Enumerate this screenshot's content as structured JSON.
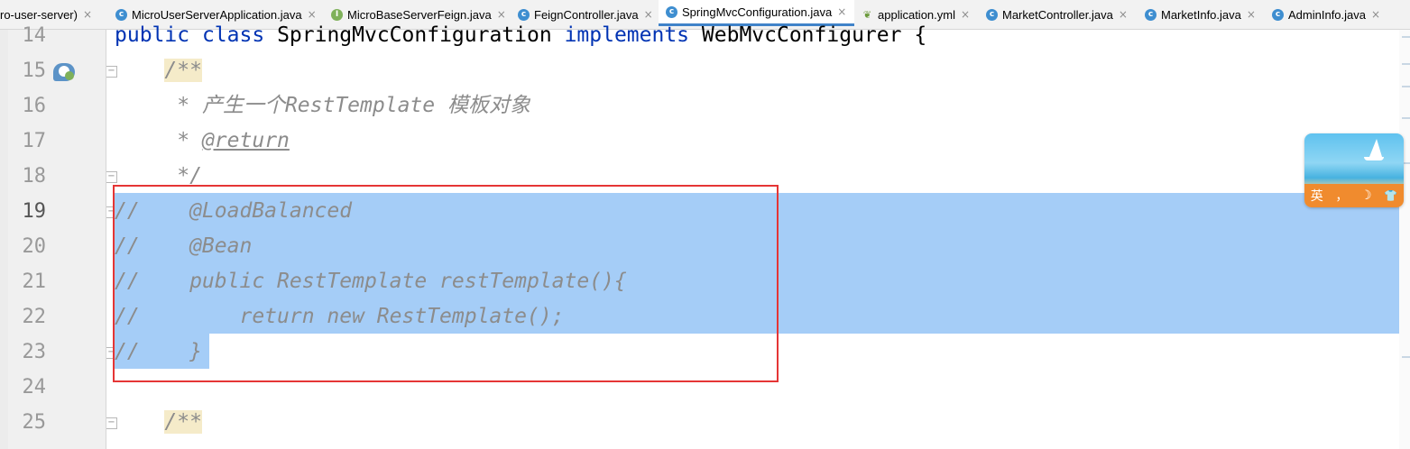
{
  "tabs": [
    {
      "label": "ro-user-server)",
      "icon": "",
      "active": false
    },
    {
      "label": "MicroUserServerApplication.java",
      "icon": "class-icon",
      "active": false
    },
    {
      "label": "MicroBaseServerFeign.java",
      "icon": "interface-icon",
      "active": false
    },
    {
      "label": "FeignController.java",
      "icon": "class-icon",
      "active": false
    },
    {
      "label": "SpringMvcConfiguration.java",
      "icon": "class-icon",
      "active": true
    },
    {
      "label": "application.yml",
      "icon": "yml-icon",
      "active": false
    },
    {
      "label": "MarketController.java",
      "icon": "class-icon",
      "active": false
    },
    {
      "label": "MarketInfo.java",
      "icon": "class-icon",
      "active": false
    },
    {
      "label": "AdminInfo.java",
      "icon": "class-icon",
      "active": false
    }
  ],
  "tab_close_glyph": "×",
  "gutter": {
    "line_numbers": [
      "14",
      "15",
      "16",
      "17",
      "18",
      "19",
      "20",
      "21",
      "22",
      "23",
      "24",
      "25"
    ],
    "current_line": "19"
  },
  "code": {
    "l14": {
      "kw1": "public",
      "kw2": "class",
      "name": "SpringMvcConfiguration",
      "kw3": "implements",
      "iface": "WebMvcConfigurer",
      "brace": "{"
    },
    "l15": {
      "doc_open": "/**"
    },
    "l16": {
      "text": "* 产生一个RestTemplate 模板对象"
    },
    "l17": {
      "star": "* ",
      "tag": "@return"
    },
    "l18": {
      "text": "*/"
    },
    "l19": {
      "text": "//    @LoadBalanced"
    },
    "l20": {
      "text": "//    @Bean"
    },
    "l21": {
      "text": "//    public RestTemplate restTemplate(){"
    },
    "l22": {
      "text": "//        return new RestTemplate();"
    },
    "l23": {
      "text": "//    }"
    },
    "l25": {
      "doc_open": "/**"
    }
  },
  "ime": {
    "lang": "英",
    "moon": "☽",
    "punct": "，",
    "shirt": "👕"
  },
  "colors": {
    "selection": "#a5cdf7",
    "annotation_box": "#e53535",
    "keyword": "#0033b3",
    "comment": "#8c8c8c"
  }
}
